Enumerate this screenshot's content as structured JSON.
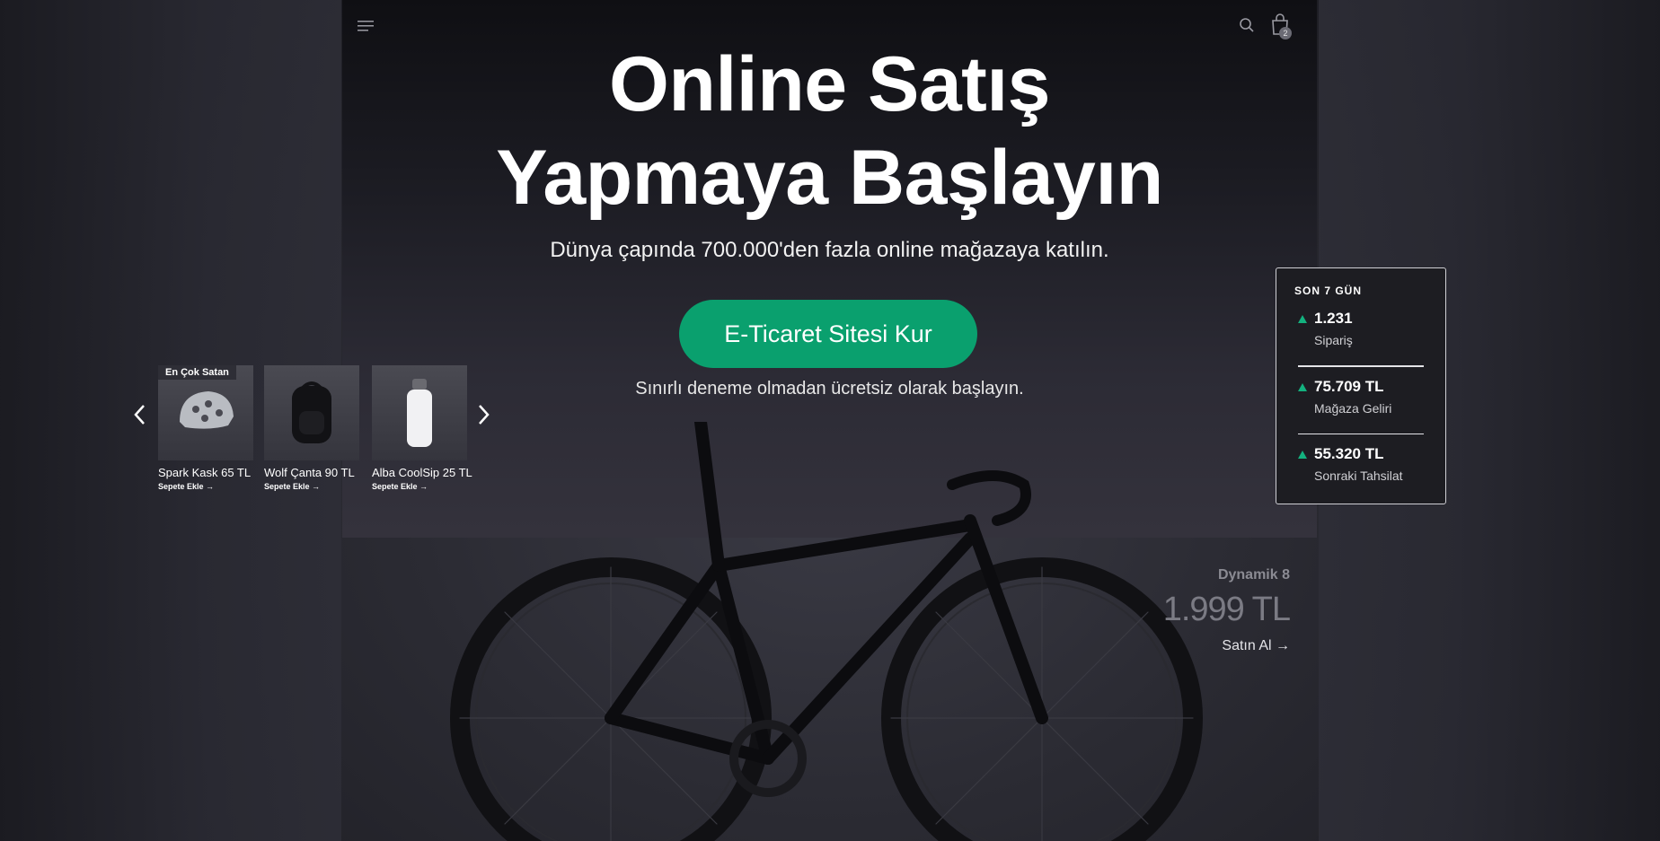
{
  "header": {
    "menu_icon": "hamburger-icon",
    "search_icon": "search-icon",
    "bag_icon": "shopping-bag-icon",
    "bag_count": "2"
  },
  "hero": {
    "title_line1": "Online Satış",
    "title_line2": "Yapmaya Başlayın",
    "subtitle": "Dünya çapında 700.000'den fazla online mağazaya katılın.",
    "cta_label": "E-Ticaret Sitesi Kur",
    "cta_color": "#0aa06e",
    "note": "Sınırlı deneme olmadan ücretsiz olarak başlayın."
  },
  "carousel": {
    "prev_icon": "chevron-left-icon",
    "next_icon": "chevron-right-icon",
    "products": [
      {
        "badge": "En Çok Satan",
        "name": "Spark Kask 65 TL",
        "add_label": "Sepete Ekle →",
        "icon": "helmet-icon"
      },
      {
        "badge": "",
        "name": "Wolf Çanta 90 TL",
        "add_label": "Sepete Ekle →",
        "icon": "backpack-icon"
      },
      {
        "badge": "",
        "name": "Alba CoolSip 25 TL",
        "add_label": "Sepete Ekle →",
        "icon": "bottle-icon"
      }
    ]
  },
  "stats": {
    "title": "SON 7 GÜN",
    "accent": "#13b27f",
    "items": [
      {
        "value": "1.231",
        "label": "Sipariş"
      },
      {
        "value": "75.709 TL",
        "label": "Mağaza Geliri"
      },
      {
        "value": "55.320 TL",
        "label": "Sonraki Tahsilat"
      }
    ]
  },
  "featured": {
    "name": "Dynamik 8",
    "price": "1.999 TL",
    "buy_label": "Satın Al →"
  }
}
